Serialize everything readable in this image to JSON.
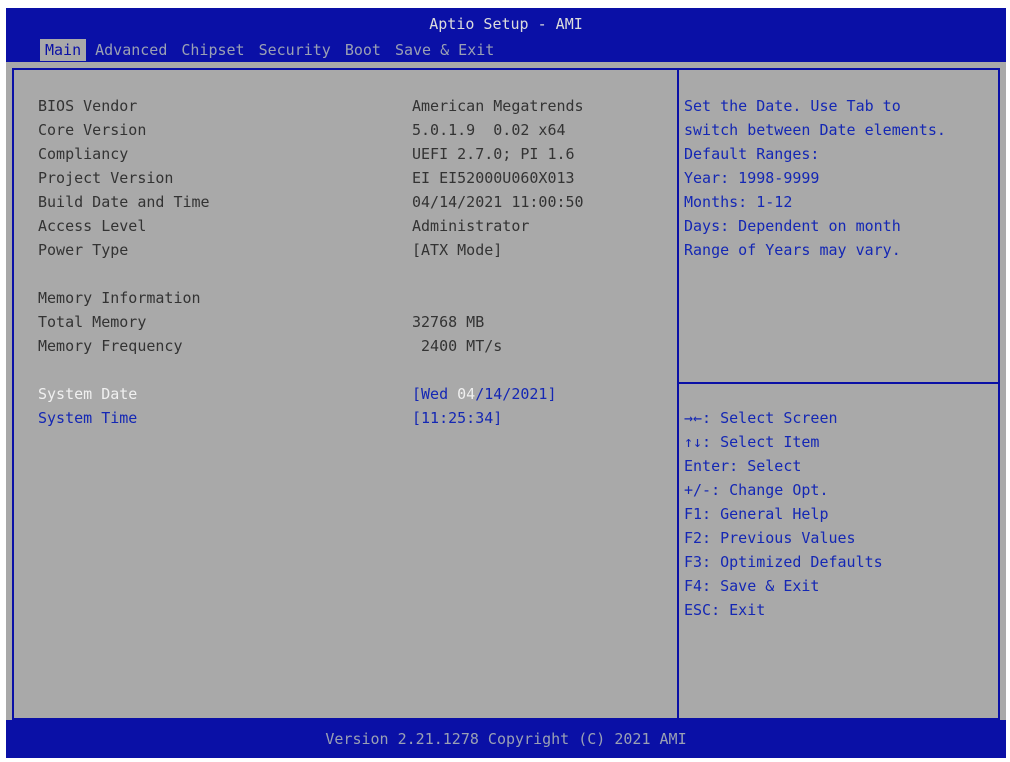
{
  "app": {
    "title": "Aptio Setup - AMI"
  },
  "tabs": [
    {
      "label": "Main",
      "active": true
    },
    {
      "label": "Advanced"
    },
    {
      "label": "Chipset"
    },
    {
      "label": "Security"
    },
    {
      "label": "Boot"
    },
    {
      "label": "Save & Exit"
    }
  ],
  "info": {
    "bios_vendor": {
      "label": "BIOS Vendor",
      "value": "American Megatrends"
    },
    "core_version": {
      "label": "Core Version",
      "value": "5.0.1.9  0.02 x64"
    },
    "compliancy": {
      "label": "Compliancy",
      "value": "UEFI 2.7.0; PI 1.6"
    },
    "project_version": {
      "label": "Project Version",
      "value": "EI EI52000U060X013"
    },
    "build_date": {
      "label": "Build Date and Time",
      "value": "04/14/2021 11:00:50"
    },
    "access_level": {
      "label": "Access Level",
      "value": "Administrator"
    },
    "power_type": {
      "label": "Power Type",
      "value": "[ATX Mode]"
    }
  },
  "memory": {
    "heading": "Memory Information",
    "total": {
      "label": "Total Memory",
      "value": "32768 MB"
    },
    "frequency": {
      "label": "Memory Frequency",
      "value": " 2400 MT/s"
    }
  },
  "system": {
    "date": {
      "label": "System Date",
      "value_prefix": "[Wed ",
      "value_selected": "04",
      "value_suffix": "/14/2021]"
    },
    "time": {
      "label": "System Time",
      "value": "[11:25:34]"
    }
  },
  "help": {
    "lines": [
      "Set the Date. Use Tab to",
      "switch between Date elements.",
      "Default Ranges:",
      "Year: 1998-9999",
      "Months: 1-12",
      "Days: Dependent on month",
      "Range of Years may vary."
    ]
  },
  "keys": [
    "→←: Select Screen",
    "↑↓: Select Item",
    "Enter: Select",
    "+/-: Change Opt.",
    "F1: General Help",
    "F2: Previous Values",
    "F3: Optimized Defaults",
    "F4: Save & Exit",
    "ESC: Exit"
  ],
  "footer": {
    "version": "Version 2.21.1278 Copyright (C) 2021 AMI"
  },
  "colors": {
    "header_blue": "#0a10a6",
    "background_gray": "#a9a9a9",
    "item_blue": "#1427b4"
  }
}
